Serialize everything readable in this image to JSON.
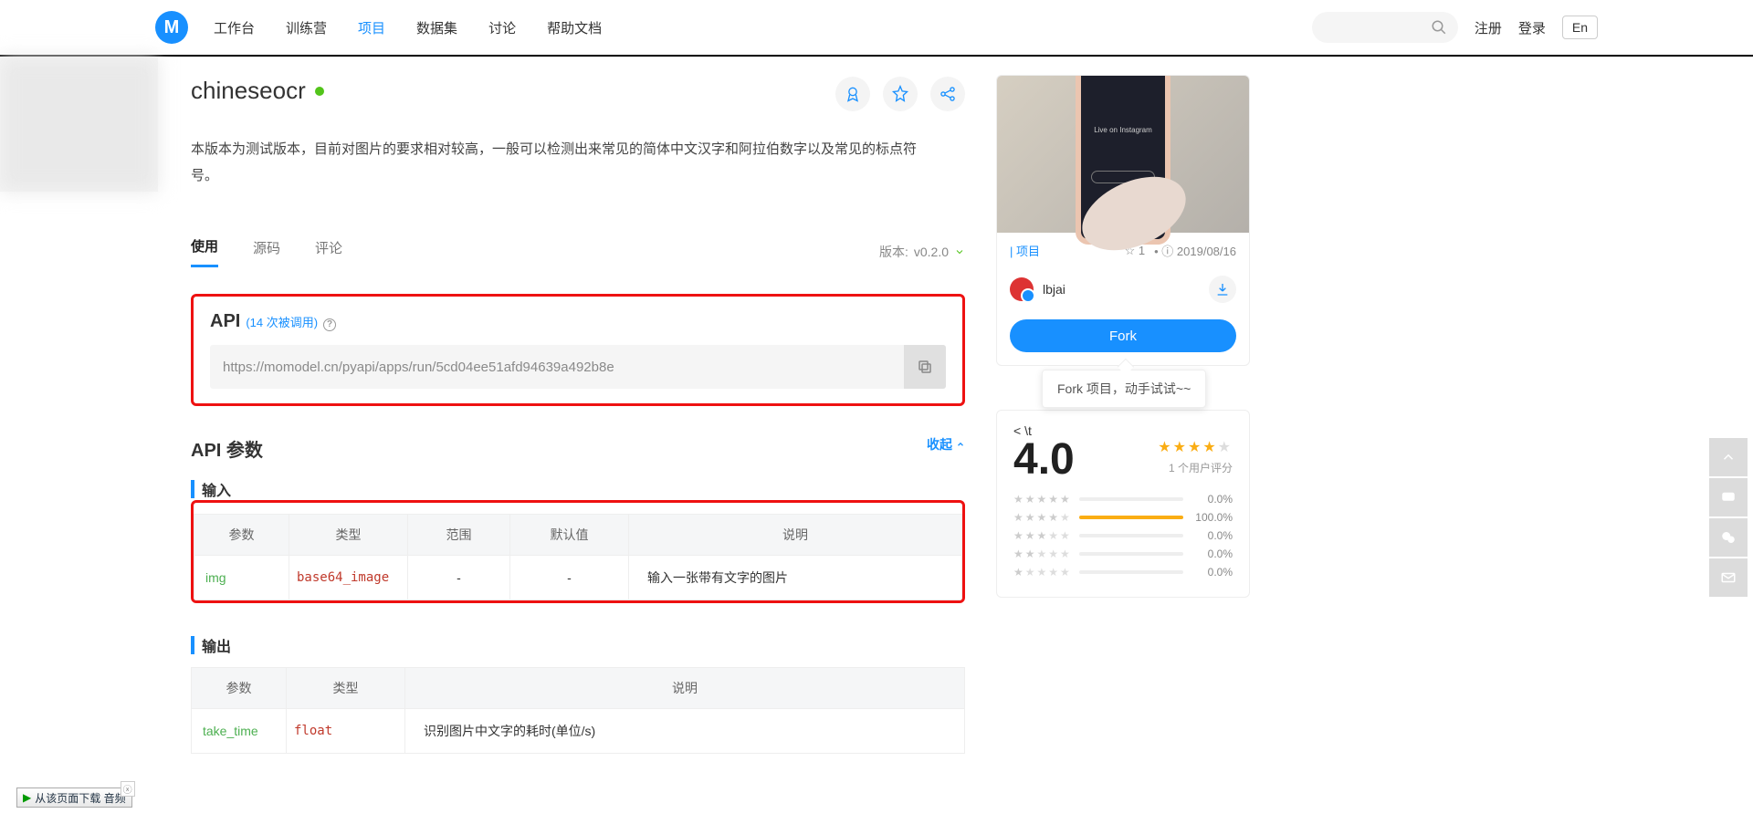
{
  "nav": {
    "items": [
      "工作台",
      "训练营",
      "项目",
      "数据集",
      "讨论",
      "帮助文档"
    ],
    "active_index": 2,
    "register": "注册",
    "login": "登录",
    "lang": "En"
  },
  "project": {
    "title": "chineseocr",
    "description": "本版本为测试版本，目前对图片的要求相对较高，一般可以检测出来常见的简体中文汉字和阿拉伯数字以及常见的标点符号。"
  },
  "tabs": {
    "use": "使用",
    "source": "源码",
    "comments": "评论",
    "version_label": "版本:",
    "version": "v0.2.0"
  },
  "api": {
    "title": "API",
    "count_text": "(14 次被调用)",
    "url": "https://momodel.cn/pyapi/apps/run/5cd04ee51afd94639a492b8e"
  },
  "params": {
    "section_title": "API 参数",
    "collapse": "收起",
    "input_label": "输入",
    "output_label": "输出",
    "input_headers": [
      "参数",
      "类型",
      "范围",
      "默认值",
      "说明"
    ],
    "input_rows": [
      {
        "name": "img",
        "type": "base64_image",
        "range": "-",
        "default": "-",
        "desc": "输入一张带有文字的图片"
      }
    ],
    "output_headers": [
      "参数",
      "类型",
      "说明"
    ],
    "output_rows": [
      {
        "name": "take_time",
        "type": "float",
        "desc": "识别图片中文字的耗时(单位/s)"
      }
    ]
  },
  "sidebar": {
    "phone_text": "Live on Instagram",
    "meta_tag": "| 项目",
    "stars": "1",
    "date": "2019/08/16",
    "author": "lbjai",
    "fork": "Fork",
    "tooltip": "Fork 项目，动手试试~~"
  },
  "rating": {
    "score": "4.0",
    "stars_on": 4,
    "users_text": "1 个用户评分",
    "rows": [
      {
        "stars": 5,
        "pct": "0.0%",
        "fill": 0
      },
      {
        "stars": 4,
        "pct": "100.0%",
        "fill": 100
      },
      {
        "stars": 3,
        "pct": "0.0%",
        "fill": 0
      },
      {
        "stars": 2,
        "pct": "0.0%",
        "fill": 0
      },
      {
        "stars": 1,
        "pct": "0.0%",
        "fill": 0
      }
    ]
  },
  "download_bar": "从该页面下载 音频"
}
